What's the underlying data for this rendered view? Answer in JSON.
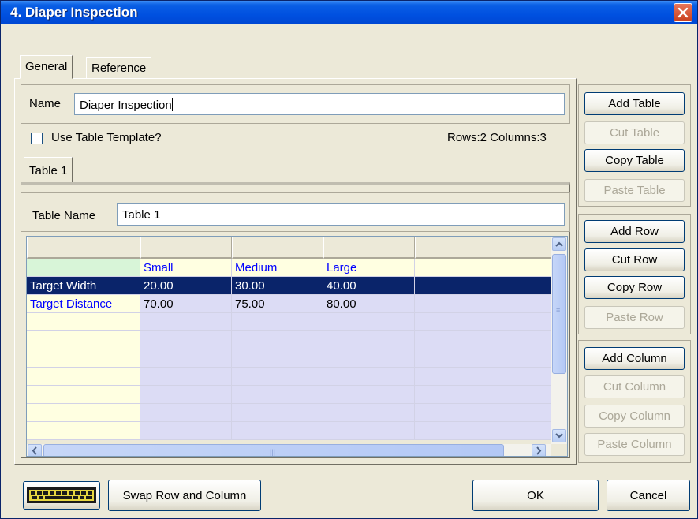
{
  "window": {
    "title": "4. Diaper Inspection"
  },
  "tabs": {
    "general": "General",
    "reference": "Reference"
  },
  "name_field": {
    "label": "Name",
    "value": "Diaper Inspection"
  },
  "template": {
    "label": "Use Table Template?",
    "checked": false
  },
  "dimensions": "Rows:2  Columns:3",
  "table_tabs": [
    "Table 1"
  ],
  "table_name": {
    "label": "Table Name",
    "value": "Table 1"
  },
  "table": {
    "column_headers": [
      "",
      "Small",
      "Medium",
      "Large",
      ""
    ],
    "rows": [
      {
        "label": "Target Width",
        "values": [
          "20.00",
          "30.00",
          "40.00"
        ],
        "selected": true
      },
      {
        "label": "Target Distance",
        "values": [
          "70.00",
          "75.00",
          "80.00"
        ],
        "selected": false
      }
    ]
  },
  "table_buttons": {
    "add": "Add Table",
    "cut": "Cut Table",
    "copy": "Copy Table",
    "paste": "Paste Table"
  },
  "row_buttons": {
    "add": "Add Row",
    "cut": "Cut Row",
    "copy": "Copy Row",
    "paste": "Paste Row"
  },
  "column_buttons": {
    "add": "Add Column",
    "cut": "Cut Column",
    "copy": "Copy Column",
    "paste": "Paste Column"
  },
  "bottom": {
    "swap": "Swap Row and Column",
    "ok": "OK",
    "cancel": "Cancel"
  },
  "icons": {
    "close": "close-icon",
    "keyboard": "keyboard-icon"
  }
}
